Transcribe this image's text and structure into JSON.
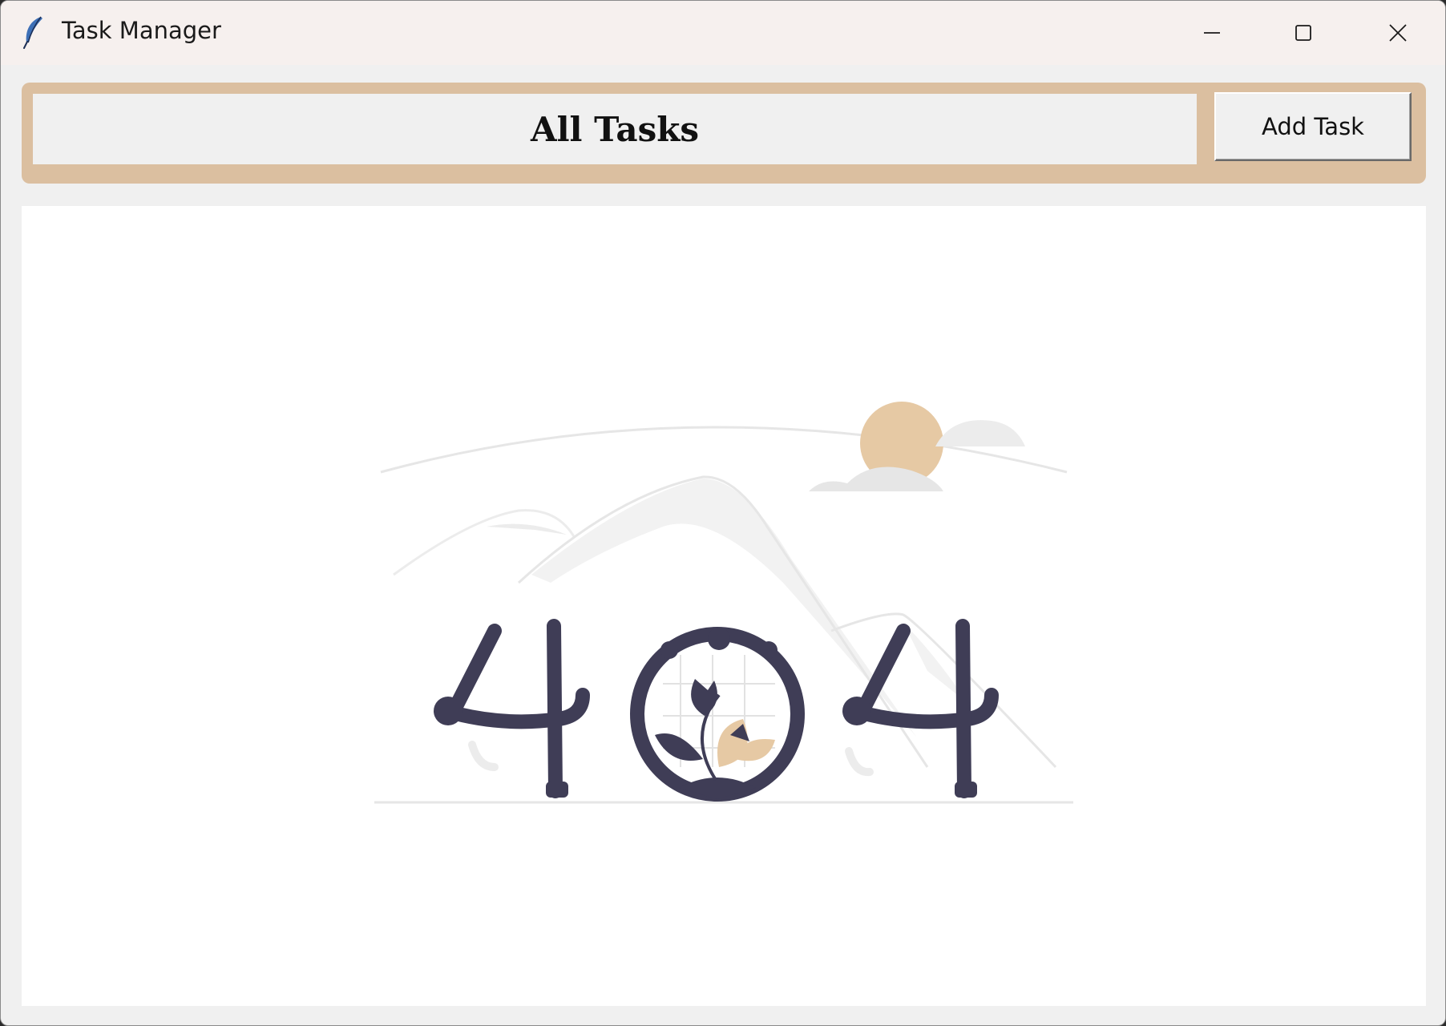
{
  "window": {
    "title": "Task Manager",
    "controls": {
      "minimize_icon": "minimize-icon",
      "maximize_icon": "maximize-icon",
      "close_icon": "close-icon"
    }
  },
  "header": {
    "title": "All Tasks",
    "add_button_label": "Add Task"
  },
  "empty_state": {
    "illustration": "404-not-found-illustration",
    "text": "404"
  },
  "colors": {
    "header_bar": "#dbbfa0",
    "illustration_dark": "#3f3d56",
    "illustration_accent": "#e6c9a4",
    "illustration_light": "#f2f2f2"
  }
}
